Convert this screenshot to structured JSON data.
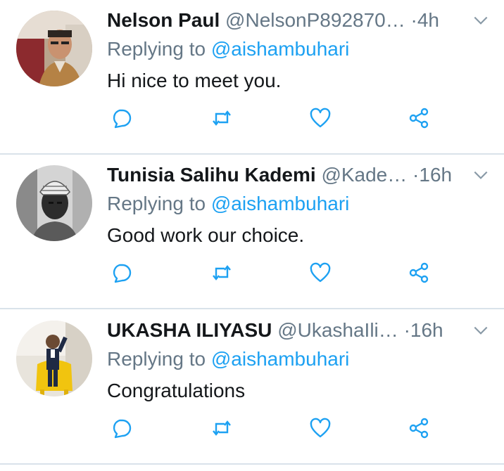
{
  "colors": {
    "accent": "#1da1f2",
    "secondary_text": "#657786",
    "primary_text": "#14171a",
    "divider": "#d9e2ea"
  },
  "reply_prefix": "Replying to",
  "tweets": [
    {
      "name": "Nelson Paul",
      "handle": "@NelsonP892870…",
      "separator": "·",
      "time": "4h",
      "mention": "@aishambuhari",
      "text": "Hi nice to meet you.",
      "avatar": "man-in-cafe-photo"
    },
    {
      "name": "Tunisia Salihu Kademi",
      "handle": "@Kade…",
      "separator": "·",
      "time": "16h",
      "mention": "@aishambuhari",
      "text": "Good work our choice.",
      "avatar": "man-in-cap-bw-photo"
    },
    {
      "name": "UKASHA ILIYASU",
      "handle": "@UkashaIli…",
      "separator": "·",
      "time": "16h",
      "mention": "@aishambuhari",
      "text": "Congratulations",
      "avatar": "child-on-yellow-chair-photo"
    }
  ],
  "actions": [
    "reply-icon",
    "retweet-icon",
    "like-icon",
    "share-icon"
  ]
}
